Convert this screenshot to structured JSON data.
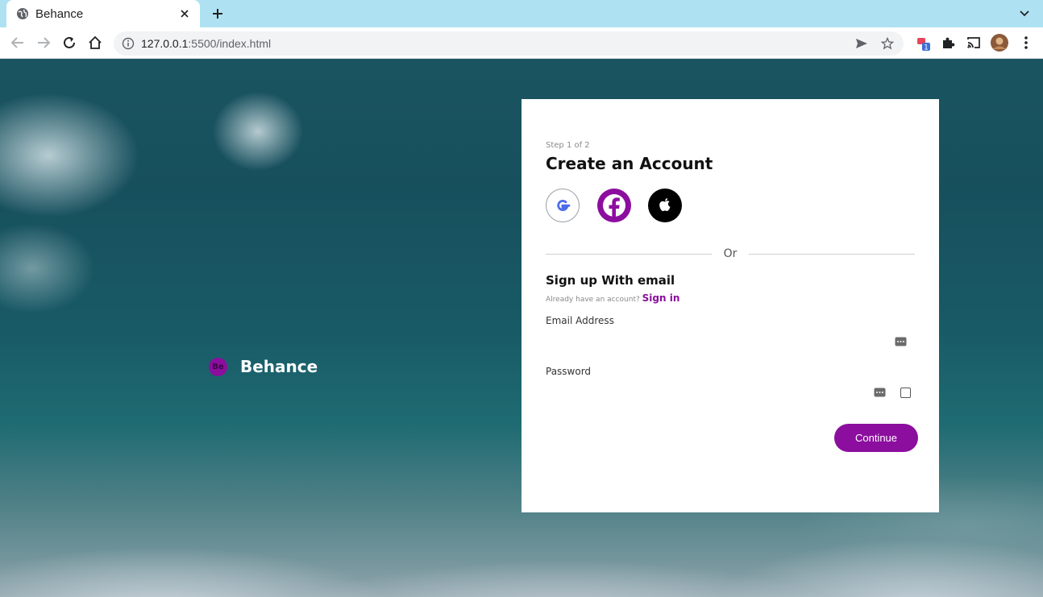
{
  "browser": {
    "tab_title": "Behance",
    "url_host": "127.0.0.1",
    "url_path": ":5500/index.html",
    "extension_badge": "1"
  },
  "page": {
    "brand": {
      "logo_text": "Be",
      "name": "Behance",
      "accent_color": "#8c0e9e"
    },
    "form": {
      "step": "Step 1 of 2",
      "title": "Create an Account",
      "social": [
        "google-icon",
        "facebook-icon",
        "apple-icon"
      ],
      "divider_text": "Or",
      "subtitle": "Sign up With email",
      "already_text": "Already have an account?",
      "signin_link": "Sign in",
      "email_label": "Email Address",
      "email_value": "",
      "password_label": "Password",
      "password_value": "",
      "continue_label": "Continue"
    }
  }
}
